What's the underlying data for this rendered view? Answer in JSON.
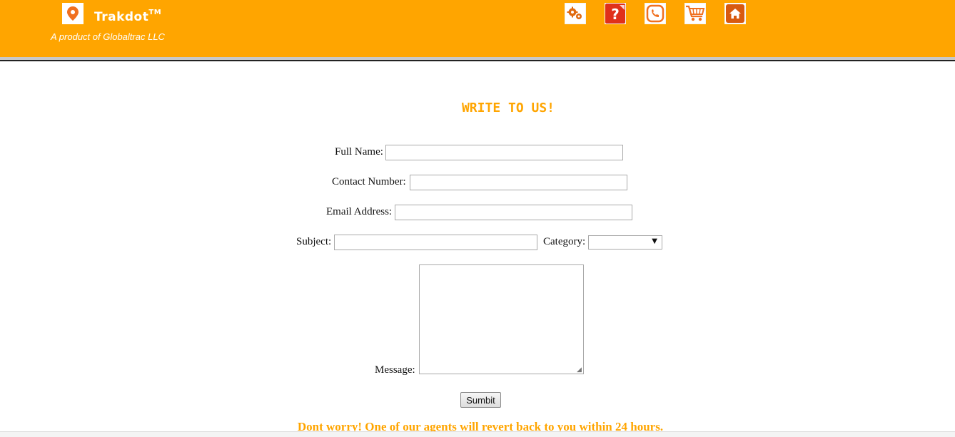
{
  "header": {
    "brand": "Trakdot",
    "trademark": "TM",
    "tagline": "A product of Globaltrac LLC",
    "background": "#ffa500",
    "logo_icon": "location-pin-icon",
    "nav_icons": [
      "settings-gears-icon",
      "help-question-icon",
      "contact-phone-icon",
      "shopping-cart-icon",
      "home-icon"
    ]
  },
  "form": {
    "title": "WRITE TO US!",
    "full_name_label": "Full Name:",
    "full_name_value": "",
    "contact_number_label": "Contact Number:",
    "contact_number_value": "",
    "email_label": "Email Address:",
    "email_value": "",
    "subject_label": "Subject:",
    "subject_value": "",
    "category_label": "Category:",
    "category_value": "",
    "message_label": "Message:",
    "message_value": "",
    "submit_label": "Sumbit",
    "note": "Dont worry! One of our agents will revert back to you within 24 hours.",
    "accent": "#ffa500"
  }
}
